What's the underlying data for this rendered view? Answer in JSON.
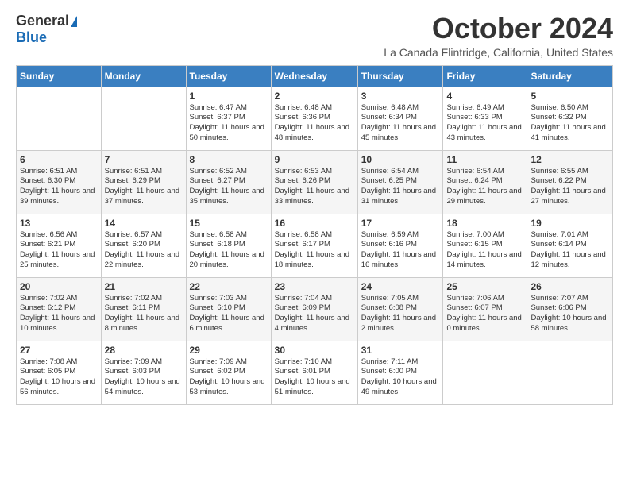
{
  "logo": {
    "general": "General",
    "blue": "Blue"
  },
  "title": "October 2024",
  "location": "La Canada Flintridge, California, United States",
  "weekdays": [
    "Sunday",
    "Monday",
    "Tuesday",
    "Wednesday",
    "Thursday",
    "Friday",
    "Saturday"
  ],
  "days": [
    {
      "num": "",
      "info": ""
    },
    {
      "num": "",
      "info": ""
    },
    {
      "num": "1",
      "info": "Sunrise: 6:47 AM\nSunset: 6:37 PM\nDaylight: 11 hours and 50 minutes."
    },
    {
      "num": "2",
      "info": "Sunrise: 6:48 AM\nSunset: 6:36 PM\nDaylight: 11 hours and 48 minutes."
    },
    {
      "num": "3",
      "info": "Sunrise: 6:48 AM\nSunset: 6:34 PM\nDaylight: 11 hours and 45 minutes."
    },
    {
      "num": "4",
      "info": "Sunrise: 6:49 AM\nSunset: 6:33 PM\nDaylight: 11 hours and 43 minutes."
    },
    {
      "num": "5",
      "info": "Sunrise: 6:50 AM\nSunset: 6:32 PM\nDaylight: 11 hours and 41 minutes."
    },
    {
      "num": "6",
      "info": "Sunrise: 6:51 AM\nSunset: 6:30 PM\nDaylight: 11 hours and 39 minutes."
    },
    {
      "num": "7",
      "info": "Sunrise: 6:51 AM\nSunset: 6:29 PM\nDaylight: 11 hours and 37 minutes."
    },
    {
      "num": "8",
      "info": "Sunrise: 6:52 AM\nSunset: 6:27 PM\nDaylight: 11 hours and 35 minutes."
    },
    {
      "num": "9",
      "info": "Sunrise: 6:53 AM\nSunset: 6:26 PM\nDaylight: 11 hours and 33 minutes."
    },
    {
      "num": "10",
      "info": "Sunrise: 6:54 AM\nSunset: 6:25 PM\nDaylight: 11 hours and 31 minutes."
    },
    {
      "num": "11",
      "info": "Sunrise: 6:54 AM\nSunset: 6:24 PM\nDaylight: 11 hours and 29 minutes."
    },
    {
      "num": "12",
      "info": "Sunrise: 6:55 AM\nSunset: 6:22 PM\nDaylight: 11 hours and 27 minutes."
    },
    {
      "num": "13",
      "info": "Sunrise: 6:56 AM\nSunset: 6:21 PM\nDaylight: 11 hours and 25 minutes."
    },
    {
      "num": "14",
      "info": "Sunrise: 6:57 AM\nSunset: 6:20 PM\nDaylight: 11 hours and 22 minutes."
    },
    {
      "num": "15",
      "info": "Sunrise: 6:58 AM\nSunset: 6:18 PM\nDaylight: 11 hours and 20 minutes."
    },
    {
      "num": "16",
      "info": "Sunrise: 6:58 AM\nSunset: 6:17 PM\nDaylight: 11 hours and 18 minutes."
    },
    {
      "num": "17",
      "info": "Sunrise: 6:59 AM\nSunset: 6:16 PM\nDaylight: 11 hours and 16 minutes."
    },
    {
      "num": "18",
      "info": "Sunrise: 7:00 AM\nSunset: 6:15 PM\nDaylight: 11 hours and 14 minutes."
    },
    {
      "num": "19",
      "info": "Sunrise: 7:01 AM\nSunset: 6:14 PM\nDaylight: 11 hours and 12 minutes."
    },
    {
      "num": "20",
      "info": "Sunrise: 7:02 AM\nSunset: 6:12 PM\nDaylight: 11 hours and 10 minutes."
    },
    {
      "num": "21",
      "info": "Sunrise: 7:02 AM\nSunset: 6:11 PM\nDaylight: 11 hours and 8 minutes."
    },
    {
      "num": "22",
      "info": "Sunrise: 7:03 AM\nSunset: 6:10 PM\nDaylight: 11 hours and 6 minutes."
    },
    {
      "num": "23",
      "info": "Sunrise: 7:04 AM\nSunset: 6:09 PM\nDaylight: 11 hours and 4 minutes."
    },
    {
      "num": "24",
      "info": "Sunrise: 7:05 AM\nSunset: 6:08 PM\nDaylight: 11 hours and 2 minutes."
    },
    {
      "num": "25",
      "info": "Sunrise: 7:06 AM\nSunset: 6:07 PM\nDaylight: 11 hours and 0 minutes."
    },
    {
      "num": "26",
      "info": "Sunrise: 7:07 AM\nSunset: 6:06 PM\nDaylight: 10 hours and 58 minutes."
    },
    {
      "num": "27",
      "info": "Sunrise: 7:08 AM\nSunset: 6:05 PM\nDaylight: 10 hours and 56 minutes."
    },
    {
      "num": "28",
      "info": "Sunrise: 7:09 AM\nSunset: 6:03 PM\nDaylight: 10 hours and 54 minutes."
    },
    {
      "num": "29",
      "info": "Sunrise: 7:09 AM\nSunset: 6:02 PM\nDaylight: 10 hours and 53 minutes."
    },
    {
      "num": "30",
      "info": "Sunrise: 7:10 AM\nSunset: 6:01 PM\nDaylight: 10 hours and 51 minutes."
    },
    {
      "num": "31",
      "info": "Sunrise: 7:11 AM\nSunset: 6:00 PM\nDaylight: 10 hours and 49 minutes."
    },
    {
      "num": "",
      "info": ""
    },
    {
      "num": "",
      "info": ""
    }
  ]
}
